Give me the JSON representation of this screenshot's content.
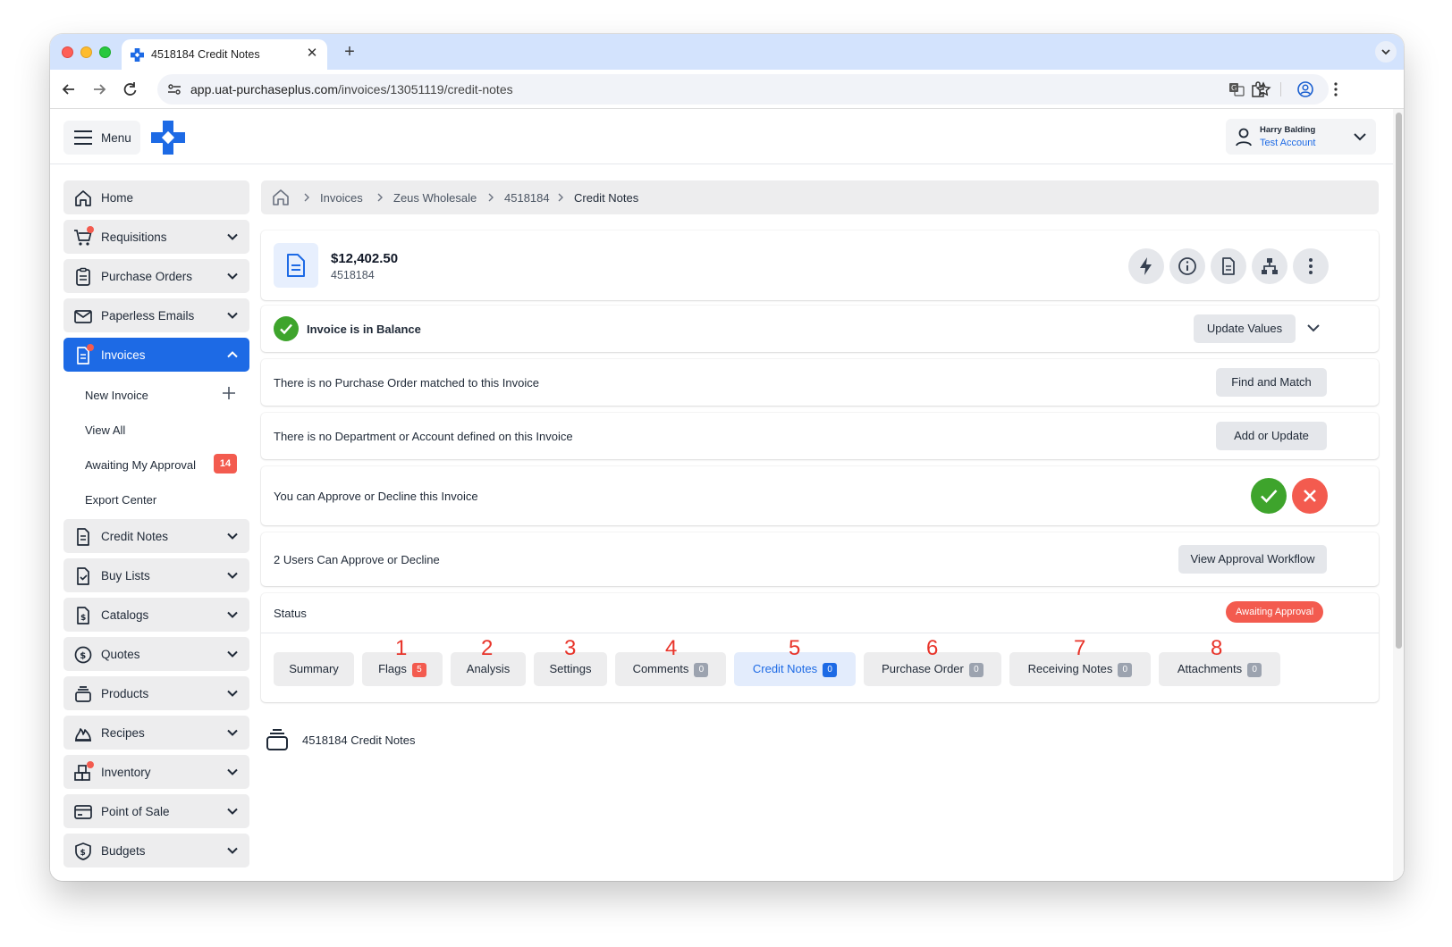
{
  "browser": {
    "tab_title": "4518184 Credit Notes",
    "url_host": "app.uat-purchaseplus.com",
    "url_path": "/invoices/13051119/credit-notes"
  },
  "header": {
    "menu_label": "Menu",
    "user_name": "Harry Balding",
    "user_account": "Test Account"
  },
  "sidebar": {
    "items": [
      {
        "label": "Home",
        "icon": "home-icon"
      },
      {
        "label": "Requisitions",
        "icon": "cart-icon"
      },
      {
        "label": "Purchase Orders",
        "icon": "clipboard-icon"
      },
      {
        "label": "Paperless Emails",
        "icon": "envelope-icon"
      },
      {
        "label": "Invoices",
        "icon": "document-icon"
      },
      {
        "label": "Credit Notes",
        "icon": "document-icon"
      },
      {
        "label": "Buy Lists",
        "icon": "checklist-icon"
      },
      {
        "label": "Catalogs",
        "icon": "dollar-document-icon"
      },
      {
        "label": "Quotes",
        "icon": "dollar-circle-icon"
      },
      {
        "label": "Products",
        "icon": "stack-icon"
      },
      {
        "label": "Recipes",
        "icon": "flame-icon"
      },
      {
        "label": "Inventory",
        "icon": "boxes-icon"
      },
      {
        "label": "Point of Sale",
        "icon": "card-icon"
      },
      {
        "label": "Budgets",
        "icon": "shield-dollar-icon"
      }
    ],
    "invoice_sub": [
      {
        "label": "New Invoice"
      },
      {
        "label": "View All"
      },
      {
        "label": "Awaiting My Approval",
        "badge": "14"
      },
      {
        "label": "Export Center"
      }
    ]
  },
  "breadcrumb": [
    "Invoices",
    "Zeus Wholesale",
    "4518184",
    "Credit Notes"
  ],
  "invoice": {
    "amount": "$12,402.50",
    "number": "4518184"
  },
  "rows": {
    "balance": "Invoice is in Balance",
    "update_values": "Update Values",
    "po_text": "There is no Purchase Order matched to this Invoice",
    "find_match": "Find and Match",
    "dept_text": "There is no Department or Account defined on this Invoice",
    "add_update": "Add or Update",
    "approve_text": "You can Approve or Decline this Invoice",
    "users_text": "2 Users Can Approve or Decline",
    "view_workflow": "View Approval Workflow",
    "status_label": "Status",
    "status_value": "Awaiting Approval"
  },
  "tabs": [
    {
      "label": "Summary"
    },
    {
      "label": "Flags",
      "count": "5",
      "annotation": "1"
    },
    {
      "label": "Analysis",
      "annotation": "2"
    },
    {
      "label": "Settings",
      "annotation": "3"
    },
    {
      "label": "Comments",
      "count": "0",
      "annotation": "4"
    },
    {
      "label": "Credit Notes",
      "count": "0",
      "annotation": "5",
      "active": true
    },
    {
      "label": "Purchase Order",
      "count": "0",
      "annotation": "6"
    },
    {
      "label": "Receiving Notes",
      "count": "0",
      "annotation": "7"
    },
    {
      "label": "Attachments",
      "count": "0",
      "annotation": "8"
    }
  ],
  "section_title": "4518184 Credit Notes",
  "colors": {
    "primary": "#1d6ae5",
    "danger": "#f35b4f",
    "success": "#3ea42c",
    "annotation": "#e8342a"
  }
}
